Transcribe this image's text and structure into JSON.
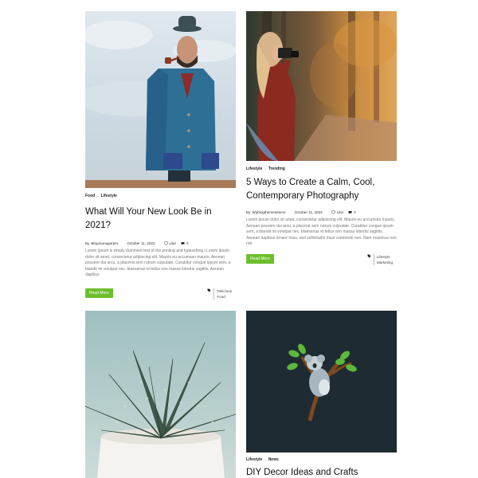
{
  "posts": [
    {
      "categories": [
        "Food",
        "Lifestyle"
      ],
      "title": "What Will Your New Look Be in 2021?",
      "author": "Blogmanagerpro",
      "date": "October 11, 2022",
      "like_label": "Like",
      "comments": "0",
      "excerpt": "Lorem Ipsum is simply dummied text of the printing and typesetting l Lorem ipsum dolor sit amet, consectetur adipiscing elit. Mauris eu accumsan mauris. Aenean posuere dui arcu, a placerat sem rutrum vulputate. Curabitur congue ipsum sem, a blandit mi volutpat nec. blaesenas et tellus non massa lobortis sagittis. Aenean dapibus",
      "read_more": "Read More",
      "tags": [
        "Delicious",
        "Food"
      ],
      "image": "man-in-blue-coat-with-pipe"
    },
    {
      "categories": [
        "Lifestyle",
        "Trending"
      ],
      "title": "5 Ways to Create a Calm, Cool, Contemporary Photography",
      "author": "Wpblogthemesdemo",
      "date": "October 11, 2022",
      "like_label": "Like",
      "comments": "0",
      "excerpt": "Lorem ipsum dolor sit amet, consectetur adipiscing elit. Mauris eu accumsan mauris. Aenean posuere dui arcu, a placerat sem rutrum vulputate. Curabitur congue ipsum sem, a blandit mi volutpat nec. blaesenas et tellus non massa lobortis sagittis. Aenean dapibus ornare risus, sed sollicitudin risus commodo non. Nam maximus non nisl",
      "read_more": "Read More",
      "tags": [
        "Lifestyle",
        "Marketing"
      ],
      "image": "woman-photographer-in-forest"
    },
    {
      "image": "succulent-plant-in-white-pot"
    },
    {
      "categories": [
        "Lifestyle",
        "News"
      ],
      "title": "DIY Decor Ideas and Crafts",
      "image": "koala-on-tree-illustration"
    }
  ],
  "icons": {
    "author": "user-icon",
    "like": "heart-icon",
    "comment": "comment-icon",
    "tag": "tag-icon"
  },
  "colors": {
    "button": "#6cbf2b",
    "title": "#111111",
    "excerpt": "#777777"
  }
}
